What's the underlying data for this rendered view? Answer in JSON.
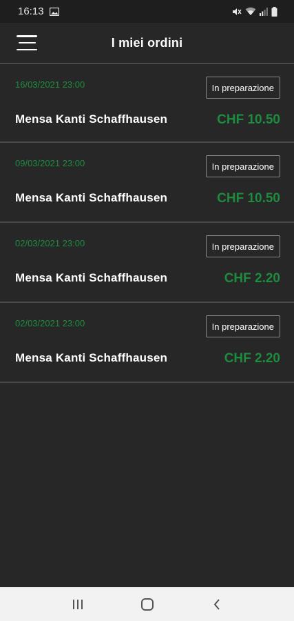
{
  "status_bar": {
    "time": "16:13",
    "icons": [
      "gallery-icon",
      "mute-icon",
      "wifi-icon",
      "signal-icon",
      "battery-icon"
    ]
  },
  "header": {
    "title": "I miei ordini",
    "menu_icon": "menu-icon"
  },
  "colors": {
    "background": "#272727",
    "accent_green": "#1e8c3e",
    "divider": "#4a4a4a",
    "nav_bar": "#f2f2f2"
  },
  "orders": [
    {
      "date": "16/03/2021 23:00",
      "status": "In preparazione",
      "name": "Mensa Kanti Schaffhausen",
      "price": "CHF 10.50"
    },
    {
      "date": "09/03/2021 23:00",
      "status": "In preparazione",
      "name": "Mensa Kanti Schaffhausen",
      "price": "CHF 10.50"
    },
    {
      "date": "02/03/2021 23:00",
      "status": "In preparazione",
      "name": "Mensa Kanti Schaffhausen",
      "price": "CHF 2.20"
    },
    {
      "date": "02/03/2021 23:00",
      "status": "In preparazione",
      "name": "Mensa Kanti Schaffhausen",
      "price": "CHF 2.20"
    }
  ],
  "nav_bar": {
    "buttons": [
      "recents-icon",
      "home-icon",
      "back-icon"
    ]
  }
}
